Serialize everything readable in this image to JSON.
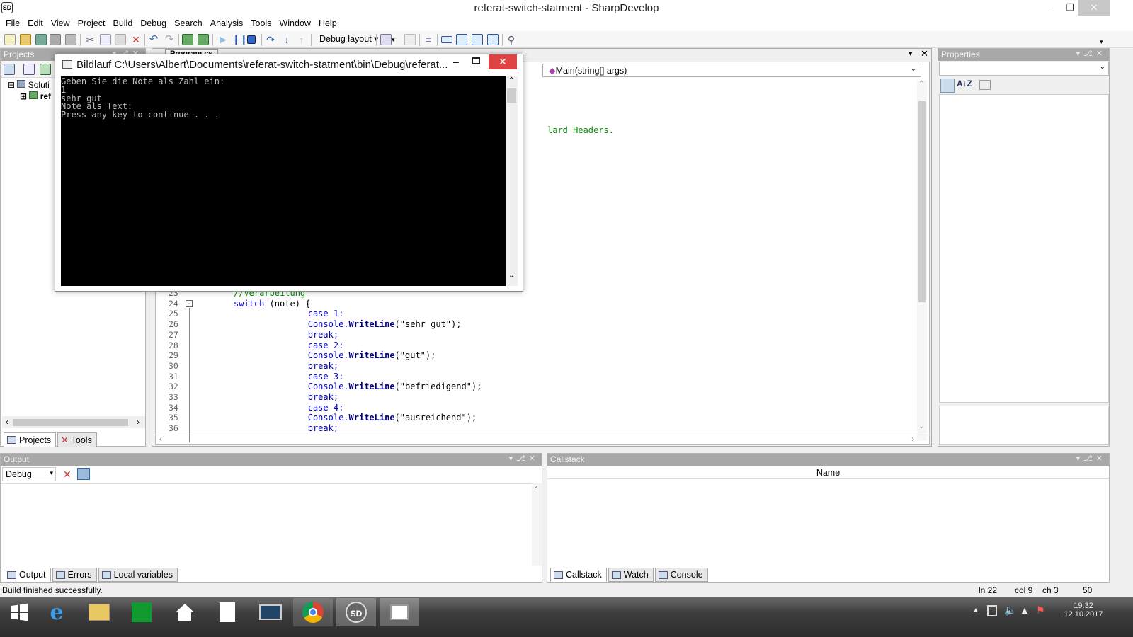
{
  "window": {
    "title": "referat-switch-statment - SharpDevelop",
    "app_icon": "SD"
  },
  "menu": [
    "File",
    "Edit",
    "View",
    "Project",
    "Build",
    "Debug",
    "Search",
    "Analysis",
    "Tools",
    "Window",
    "Help"
  ],
  "toolbar": {
    "layout_dropdown": "Debug layout"
  },
  "projects_panel": {
    "title": "Projects",
    "tree": [
      {
        "label": "Soluti"
      },
      {
        "label": "ref"
      }
    ],
    "tabs": [
      "Projects",
      "Tools"
    ]
  },
  "editor": {
    "file_tab": "Program.cs",
    "member_dropdown": "Main(string[] args)",
    "partial_comment": "lard Headers.",
    "lines": [
      {
        "n": "23",
        "text": "//Verarbeitung",
        "kind": "comment",
        "indent": 12
      },
      {
        "n": "24",
        "text_kw": "switch",
        "text_rest": " (note) {",
        "indent": 12
      },
      {
        "n": "25",
        "text_kw": "case 1:",
        "text_rest": "",
        "indent": 28
      },
      {
        "n": "26",
        "method_call": "Console.",
        "method": "WriteLine",
        "args": "(\"sehr gut\");",
        "indent": 28
      },
      {
        "n": "27",
        "text_kw": "break;",
        "text_rest": "",
        "indent": 28,
        "plain": true
      },
      {
        "n": "28",
        "text_kw": "case 2:",
        "text_rest": "",
        "indent": 28
      },
      {
        "n": "29",
        "method_call": "Console.",
        "method": "WriteLine",
        "args": "(\"gut\");",
        "indent": 28
      },
      {
        "n": "30",
        "text_kw": "break;",
        "text_rest": "",
        "indent": 28,
        "plain": true
      },
      {
        "n": "31",
        "text_kw": "case 3:",
        "text_rest": "",
        "indent": 28
      },
      {
        "n": "32",
        "method_call": "Console.",
        "method": "WriteLine",
        "args": "(\"befriedigend\");",
        "indent": 28
      },
      {
        "n": "33",
        "text_kw": "break;",
        "text_rest": "",
        "indent": 28,
        "plain": true
      },
      {
        "n": "34",
        "text_kw": "case 4:",
        "text_rest": "",
        "indent": 28
      },
      {
        "n": "35",
        "method_call": "Console.",
        "method": "WriteLine",
        "args": "(\"ausreichend\");",
        "indent": 28
      },
      {
        "n": "36",
        "text_kw": "break;",
        "text_rest": "",
        "indent": 28,
        "plain": true
      }
    ]
  },
  "console": {
    "title": "Bildlauf C:\\Users\\Albert\\Documents\\referat-switch-statment\\bin\\Debug\\referat...",
    "output": "Geben Sie die Note als Zahl ein:\n1\nsehr gut\nNote als Text:\nPress any key to continue . . ."
  },
  "properties_panel": {
    "title": "Properties"
  },
  "output_panel": {
    "title": "Output",
    "source": "Debug",
    "tabs": [
      "Output",
      "Errors",
      "Local variables"
    ]
  },
  "callstack_panel": {
    "title": "Callstack",
    "column": "Name",
    "tabs": [
      "Callstack",
      "Watch",
      "Console"
    ]
  },
  "status": {
    "message": "Build finished successfully.",
    "line": "ln 22",
    "col": "col 9",
    "ch": "ch 3",
    "extra": "50"
  },
  "taskbar": {
    "time": "19:32",
    "date": "12.10.2017"
  }
}
